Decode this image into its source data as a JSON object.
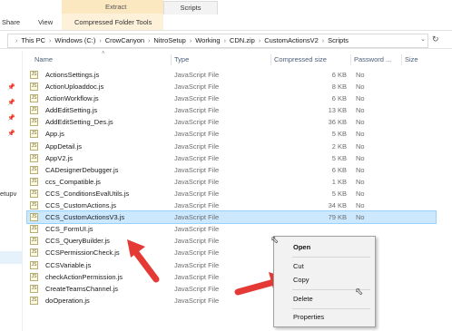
{
  "ribbon": {
    "share_tab": "Share",
    "view_tab": "View",
    "context_group_title": "Extract",
    "context_tab": "Compressed Folder Tools",
    "window_title": "Scripts"
  },
  "address": {
    "crumbs": [
      "This PC",
      "Windows (C:)",
      "CrowCanyon",
      "NitroSetup",
      "Working",
      "CDN.zip",
      "CustomActionsV2",
      "Scripts"
    ]
  },
  "nav": {
    "partial_label": "etupv"
  },
  "columns": {
    "name": "Name",
    "type": "Type",
    "compressed_size": "Compressed size",
    "password": "Password ...",
    "size": "Size"
  },
  "files": [
    {
      "name": "ActionsSettings.js",
      "type": "JavaScript File",
      "size": "6 KB",
      "pw": "No"
    },
    {
      "name": "ActionUploaddoc.js",
      "type": "JavaScript File",
      "size": "8 KB",
      "pw": "No"
    },
    {
      "name": "ActionWorkflow.js",
      "type": "JavaScript File",
      "size": "6 KB",
      "pw": "No"
    },
    {
      "name": "AddEditSetting.js",
      "type": "JavaScript File",
      "size": "13 KB",
      "pw": "No"
    },
    {
      "name": "AddEditSetting_Des.js",
      "type": "JavaScript File",
      "size": "36 KB",
      "pw": "No"
    },
    {
      "name": "App.js",
      "type": "JavaScript File",
      "size": "5 KB",
      "pw": "No"
    },
    {
      "name": "AppDetail.js",
      "type": "JavaScript File",
      "size": "2 KB",
      "pw": "No"
    },
    {
      "name": "AppV2.js",
      "type": "JavaScript File",
      "size": "5 KB",
      "pw": "No"
    },
    {
      "name": "CADesignerDebugger.js",
      "type": "JavaScript File",
      "size": "6 KB",
      "pw": "No"
    },
    {
      "name": "ccs_Compatible.js",
      "type": "JavaScript File",
      "size": "1 KB",
      "pw": "No"
    },
    {
      "name": "CCS_ConditionsEvalUtils.js",
      "type": "JavaScript File",
      "size": "5 KB",
      "pw": "No"
    },
    {
      "name": "CCS_CustomActions.js",
      "type": "JavaScript File",
      "size": "34 KB",
      "pw": "No"
    },
    {
      "name": "CCS_CustomActionsV3.js",
      "type": "JavaScript File",
      "size": "79 KB",
      "pw": "No"
    },
    {
      "name": "CCS_FormUI.js",
      "type": "JavaScript File",
      "size": "",
      "pw": ""
    },
    {
      "name": "CCS_QueryBuilder.js",
      "type": "JavaScript File",
      "size": "",
      "pw": ""
    },
    {
      "name": "CCSPermissionCheck.js",
      "type": "JavaScript File",
      "size": "",
      "pw": ""
    },
    {
      "name": "CCSVariable.js",
      "type": "JavaScript File",
      "size": "",
      "pw": ""
    },
    {
      "name": "checkActionPermission.js",
      "type": "JavaScript File",
      "size": "",
      "pw": ""
    },
    {
      "name": "CreateTeamsChannel.js",
      "type": "JavaScript File",
      "size": "",
      "pw": ""
    },
    {
      "name": "doOperation.js",
      "type": "JavaScript File",
      "size": "",
      "pw": ""
    }
  ],
  "context_menu": {
    "open": "Open",
    "cut": "Cut",
    "copy": "Copy",
    "delete": "Delete",
    "properties": "Properties"
  },
  "colors": {
    "selection": "#cce8ff",
    "annotation_arrow": "#e53935",
    "ribbon_context": "#fbe7c0"
  }
}
